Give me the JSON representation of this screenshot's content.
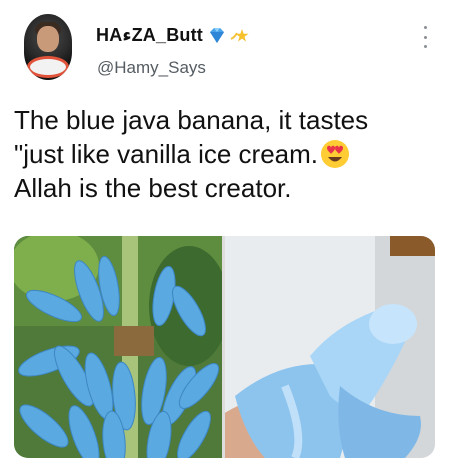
{
  "user": {
    "display_name": "HAءZA_Butt",
    "handle": "@Hamy_Says",
    "badge_icons": [
      "diamond-icon",
      "star-icon"
    ]
  },
  "tweet": {
    "lines": [
      "The blue java banana, it tastes",
      "\"just like vanilla ice cream.",
      "Allah is the best creator."
    ],
    "emoji": "heart-eyes-emoji"
  },
  "media": {
    "photos": [
      "blue-banana-bunch-photo",
      "peeled-blue-banana-photo"
    ]
  },
  "colors": {
    "text": "#111111",
    "handle": "#555c62",
    "banana_blue": "#5aa9e0",
    "avatar_ring": "#e0533a"
  }
}
